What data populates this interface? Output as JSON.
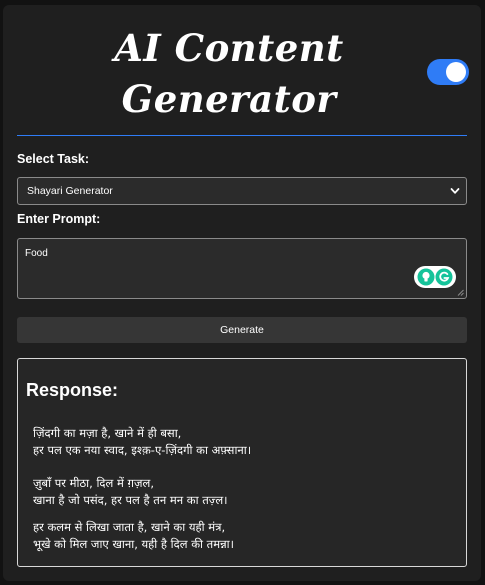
{
  "header": {
    "title_line1": "AI Content",
    "title_line2": "Generator",
    "theme_toggle": "on"
  },
  "form": {
    "task_label": "Select Task:",
    "task_selected": "Shayari Generator",
    "prompt_label": "Enter Prompt:",
    "prompt_value": "Food",
    "generate_label": "Generate"
  },
  "response": {
    "heading": "Response:",
    "stanzas": [
      [
        "ज़िंदगी का मज़ा है, खाने में ही बसा,",
        "हर पल एक नया स्वाद, इश्क़-ए-ज़िंदगी का अफ़्साना।"
      ],
      [
        "ज़ुबाँ पर मीठा, दिल में ग़ज़ल,",
        "खाना है जो पसंद, हर पल है तन मन का तज़्ल।"
      ],
      [
        "हर कलम से लिखा जाता है, खाने का यही मंत्र,",
        "भूखे को मिल जाए खाना, यही है दिल की तमन्ना।"
      ]
    ]
  },
  "colors": {
    "accent": "#2f7cf6",
    "panel": "#1f1f1f",
    "page_bg": "#121212",
    "input_bg": "#2b2b2b",
    "button_bg": "#363636",
    "assist_green": "#15c39a"
  }
}
